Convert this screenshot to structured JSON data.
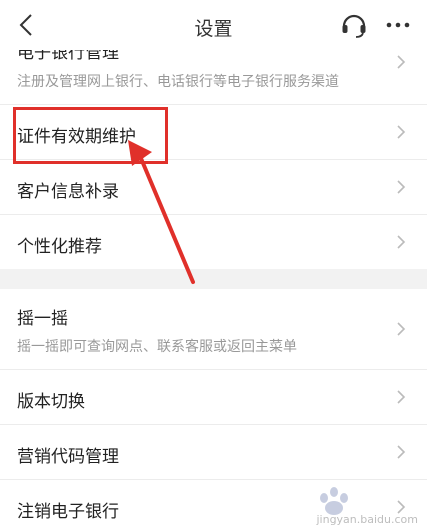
{
  "header": {
    "title": "设置",
    "back_icon": "chevron-left-icon",
    "support_icon": "headset-icon",
    "more_icon": "more-dots-icon"
  },
  "items": [
    {
      "label": "电子银行管理",
      "subtitle": "注册及管理网上银行、电话银行等电子银行服务渠道"
    },
    {
      "label": "证件有效期维护"
    },
    {
      "label": "客户信息补录"
    },
    {
      "label": "个性化推荐"
    },
    {
      "label": "摇一摇",
      "subtitle": "摇一摇即可查询网点、联系客服或返回主菜单"
    },
    {
      "label": "版本切换"
    },
    {
      "label": "营销代码管理"
    },
    {
      "label": "注销电子银行"
    }
  ],
  "annotation": {
    "color": "#e0302a",
    "target": "证件有效期维护"
  },
  "watermark": {
    "text": "jingyan.baidu.com"
  },
  "colors": {
    "section_gap": "#f2f2f2",
    "divider": "#ececec",
    "chevron": "#bbbbbb"
  }
}
